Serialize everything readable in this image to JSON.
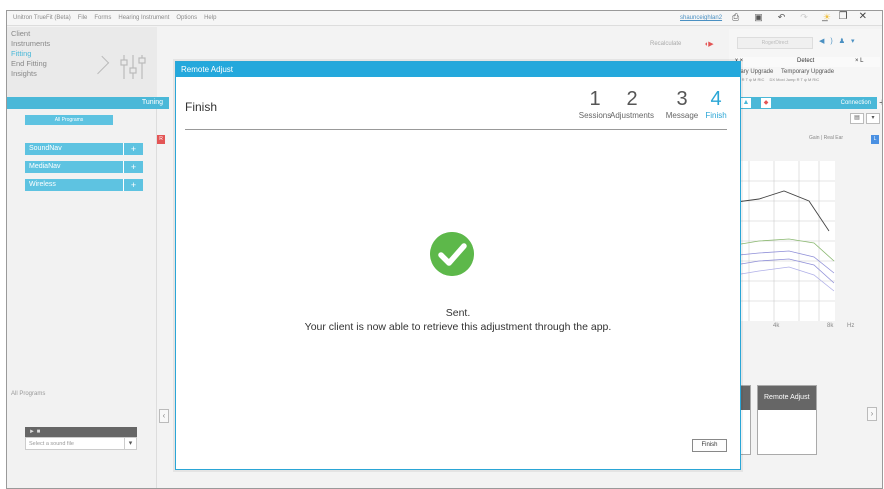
{
  "menubar": {
    "items": [
      "Unitron TrueFit (Beta)",
      "File",
      "Forms",
      "Hearing Instrument",
      "Options",
      "Help"
    ],
    "user": "shaunceighlan2"
  },
  "nav": {
    "client": "Client",
    "instruments": "Instruments",
    "fitting": "Fitting",
    "end_fitting": "End Fitting",
    "insights": "Insights",
    "tuning": "Tuning"
  },
  "sidebar": {
    "all_programs_button": "All Programs",
    "programs": [
      {
        "label": "SoundNav"
      },
      {
        "label": "MediaNav"
      },
      {
        "label": "Wireless"
      }
    ],
    "plus": "+",
    "all_programs_label": "All Programs",
    "player_label": "► ■",
    "sound_select_placeholder": "Select a sound file",
    "r_badge": "R"
  },
  "right": {
    "recalculate": "Recalculate",
    "roger_direct": "RogerDirect",
    "detect_left": "x ×",
    "detect": "Detect",
    "detect_right": "× L",
    "temp_upgrade_left": "orary Upgrade",
    "temp_upgrade_right": "Temporary Upgrade",
    "temp_sub_left": "mp R T ψ M RIC",
    "temp_sub_right": "DX Moxi Jump R T ψ M RIC",
    "connection": "Connection",
    "gain_label": "Gain | Real Ear",
    "l_badge": "L",
    "freq": [
      "k",
      "4k",
      "8k",
      "Hz"
    ],
    "tile_left": "er",
    "tile_remote": "Remote Adjust"
  },
  "modal": {
    "title": "Remote Adjust",
    "header": "Finish",
    "steps": [
      {
        "num": "1",
        "label": "Sessions"
      },
      {
        "num": "2",
        "label": "Adjustments"
      },
      {
        "num": "3",
        "label": "Message"
      },
      {
        "num": "4",
        "label": "Finish"
      }
    ],
    "active_step": 4,
    "sent": "Sent.",
    "message": "Your client is now able to retrieve this adjustment through the app.",
    "finish_button": "Finish",
    "success_color": "#5db84a",
    "accent_color": "#24a8dc"
  }
}
